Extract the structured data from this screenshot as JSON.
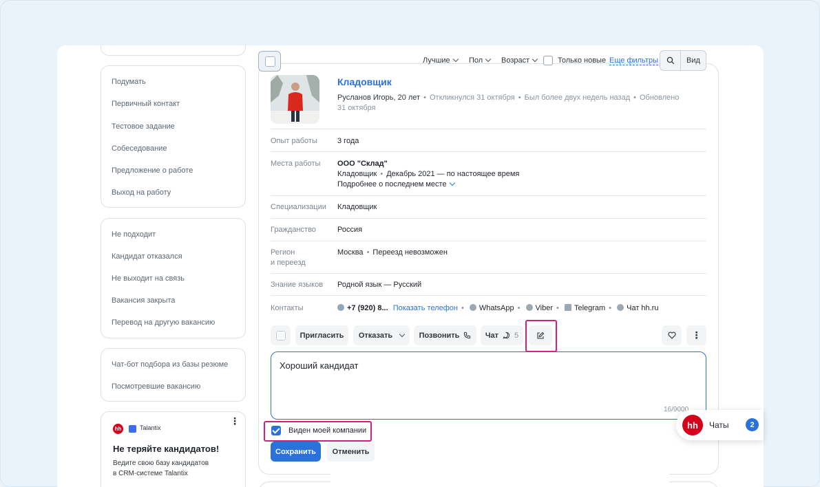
{
  "sidebar": {
    "group_stages": [
      "Подумать",
      "Первичный контакт",
      "Тестовое задание",
      "Собеседование",
      "Предложение о работе",
      "Выход на работу"
    ],
    "group_rejected": [
      "Не подходит",
      "Кандидат отказался",
      "Не выходит на связь",
      "Вакансия закрыта",
      "Перевод на другую вакансию"
    ],
    "group_other": [
      "Чат-бот подбора из базы резюме",
      "Посмотревшие вакансию"
    ],
    "promo": {
      "brand_hh": "hh",
      "brand_talantix": "Talantix",
      "title": "Не теряйте кандидатов!",
      "text_line1": "Ведите свою базу кандидатов",
      "text_line2": "в CRM-системе Talantix",
      "menu_icon": "more-vertical-icon"
    }
  },
  "toolbar": {
    "sort_label": "Лучшие",
    "gender_label": "Пол",
    "age_label": "Возраст",
    "only_new_label": "Только новые",
    "more_filters_label": "Еще фильтры",
    "view_label": "Вид",
    "search_icon": "search-icon"
  },
  "candidate": {
    "title": "Кладовщик",
    "name_age": "Русланов Игорь, 20 лет",
    "responded": "Откликнулся 31 октября",
    "last_seen": "Был более двух недель назад",
    "updated_label": "Обновлено",
    "updated_date": "31 октября",
    "rows": {
      "experience_label": "Опыт работы",
      "experience_value": "3 года",
      "workplaces_label": "Места работы",
      "company": "ООО \"Склад\"",
      "position": "Кладовщик",
      "period": "Декабрь 2021 — по настоящее время",
      "more_link": "Подробнее о последнем месте",
      "specialization_label": "Специализации",
      "specialization_value": "Кладовщик",
      "citizenship_label": "Гражданство",
      "citizenship_value": "Россия",
      "region_label_1": "Регион",
      "region_label_2": "и переезд",
      "region_city": "Москва",
      "relocation": "Переезд невозможен",
      "languages_label": "Знание языков",
      "languages_value": "Родной язык — Русский",
      "contacts_label": "Контакты",
      "phone": "+7 (920) 8...",
      "show_phone": "Показать телефон",
      "whatsapp": "WhatsApp",
      "viber": "Viber",
      "telegram": "Telegram",
      "hh_chat": "Чат hh.ru"
    }
  },
  "actions": {
    "invite": "Пригласить",
    "reject": "Отказать",
    "call": "Позвонить",
    "chat": "Чат",
    "chat_count": "5",
    "icons": [
      "edit-icon",
      "heart-icon",
      "more-vertical-icon"
    ]
  },
  "comment": {
    "value": "Хороший кандидат",
    "counter": "16/9000",
    "visibility_label": "Виден моей компании",
    "save": "Сохранить",
    "cancel": "Отменить"
  },
  "chats_widget": {
    "logo": "hh",
    "label": "Чаты",
    "badge": "2"
  },
  "colors": {
    "accent": "#2a72d9",
    "highlight": "#d0207f",
    "brand_red": "#d6001c"
  }
}
